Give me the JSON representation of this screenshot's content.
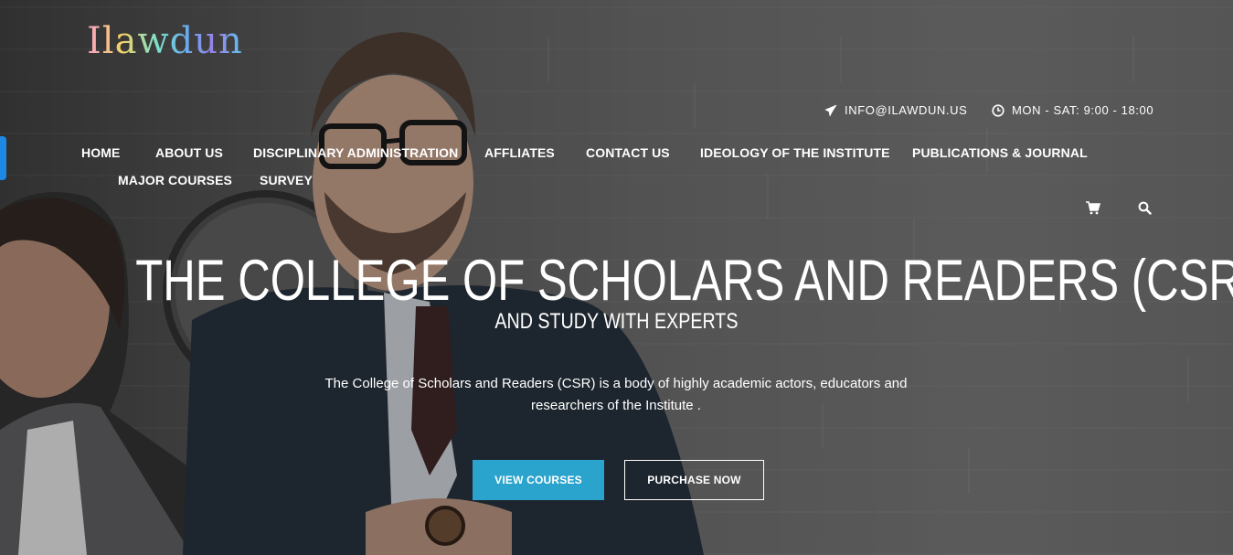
{
  "brand": {
    "logo_text": "Ilawdun"
  },
  "topbar": {
    "email": "INFO@ILAWDUN.US",
    "email_icon": "paper-plane-icon",
    "hours": "MON - SAT: 9:00 - 18:00",
    "hours_icon": "clock-icon"
  },
  "nav": {
    "items": [
      {
        "label": "HOME"
      },
      {
        "label": "ABOUT US"
      },
      {
        "label": "DISCIPLINARY ADMINISTRATION"
      },
      {
        "label": "AFFLIATES"
      },
      {
        "label": "CONTACT US"
      },
      {
        "label": "IDEOLOGY OF THE INSTITUTE"
      },
      {
        "label": "PUBLICATIONS & JOURNAL"
      },
      {
        "label": "MAJOR COURSES"
      },
      {
        "label": "SURVEY"
      }
    ],
    "cart_icon": "cart-icon",
    "search_icon": "search-icon"
  },
  "hero": {
    "title": "THE COLLEGE OF SCHOLARS AND READERS (CSR)",
    "subtitle": "AND STUDY WITH EXPERTS",
    "description": "The College of Scholars and Readers (CSR) is a body of highly academic actors, educators and researchers of the Institute .",
    "primary_button": "VIEW COURSES",
    "secondary_button": "PURCHASE NOW"
  },
  "colors": {
    "accent": "#2ba4cd",
    "side_tab": "#1e88e5",
    "text": "#ffffff"
  }
}
